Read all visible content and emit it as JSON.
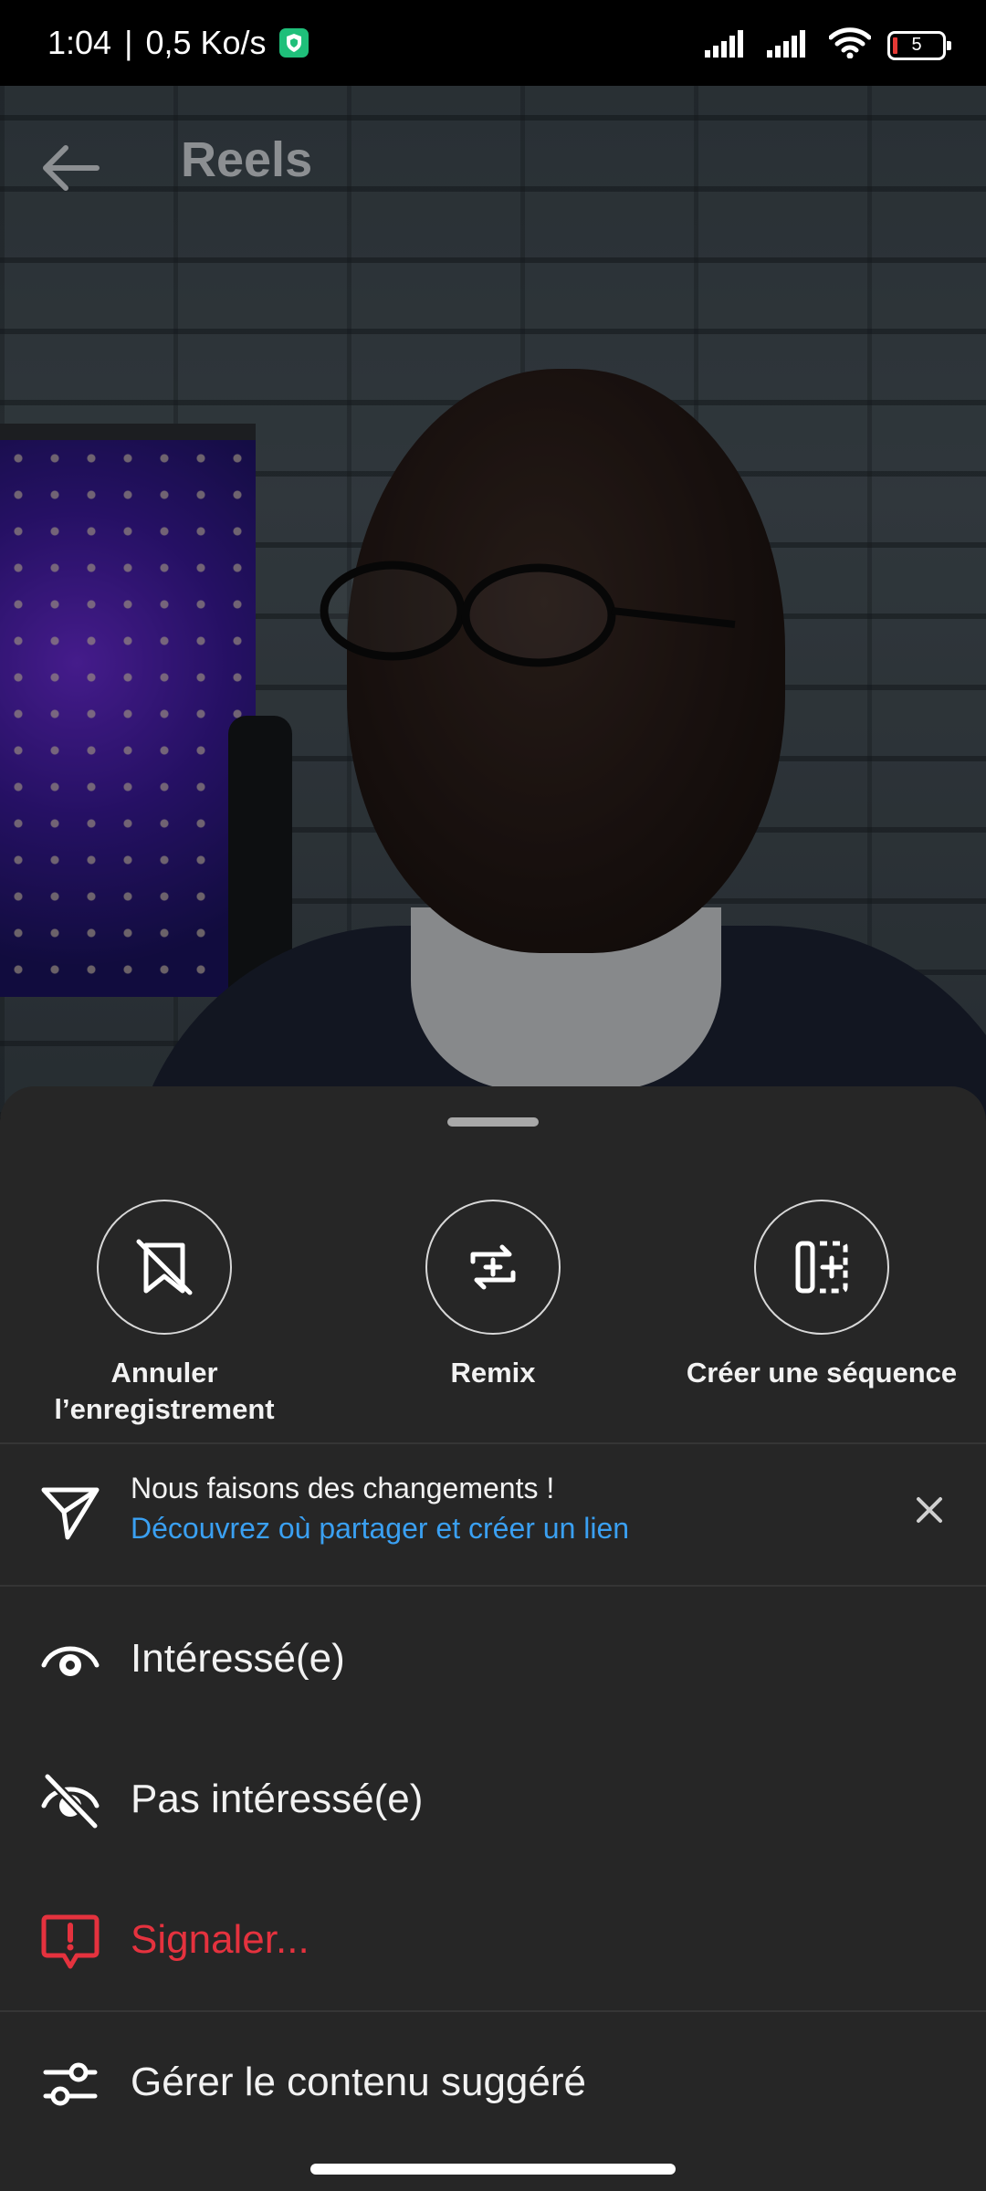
{
  "status_bar": {
    "time": "1:04",
    "speed": "0,5 Ko/s",
    "separator": "|",
    "battery_level": "5",
    "icons": [
      "vpn-shield-icon",
      "signal-icon",
      "signal-icon",
      "wifi-icon",
      "battery-icon"
    ]
  },
  "header": {
    "title": "Reels",
    "back_icon": "arrow-left-icon"
  },
  "sheet": {
    "actions": [
      {
        "label": "Annuler l’enregistrement",
        "icon": "unsave-icon"
      },
      {
        "label": "Remix",
        "icon": "remix-icon"
      },
      {
        "label": "Créer une séquence",
        "icon": "sequence-icon"
      }
    ],
    "notice": {
      "title": "Nous faisons des changements !",
      "link": "Découvrez où partager et créer un lien",
      "icon": "send-icon",
      "close_icon": "close-icon"
    },
    "menu": [
      {
        "label": "Intéressé(e)",
        "icon": "eye-icon"
      },
      {
        "label": "Pas intéressé(e)",
        "icon": "eye-off-icon"
      },
      {
        "label": "Signaler...",
        "icon": "report-icon"
      },
      {
        "label": "Gérer le contenu suggéré",
        "icon": "sliders-icon"
      }
    ]
  },
  "colors": {
    "sheet_bg": "#262626",
    "link": "#3aa0f2",
    "danger": "#e5323e",
    "text": "#f2f2f2"
  }
}
